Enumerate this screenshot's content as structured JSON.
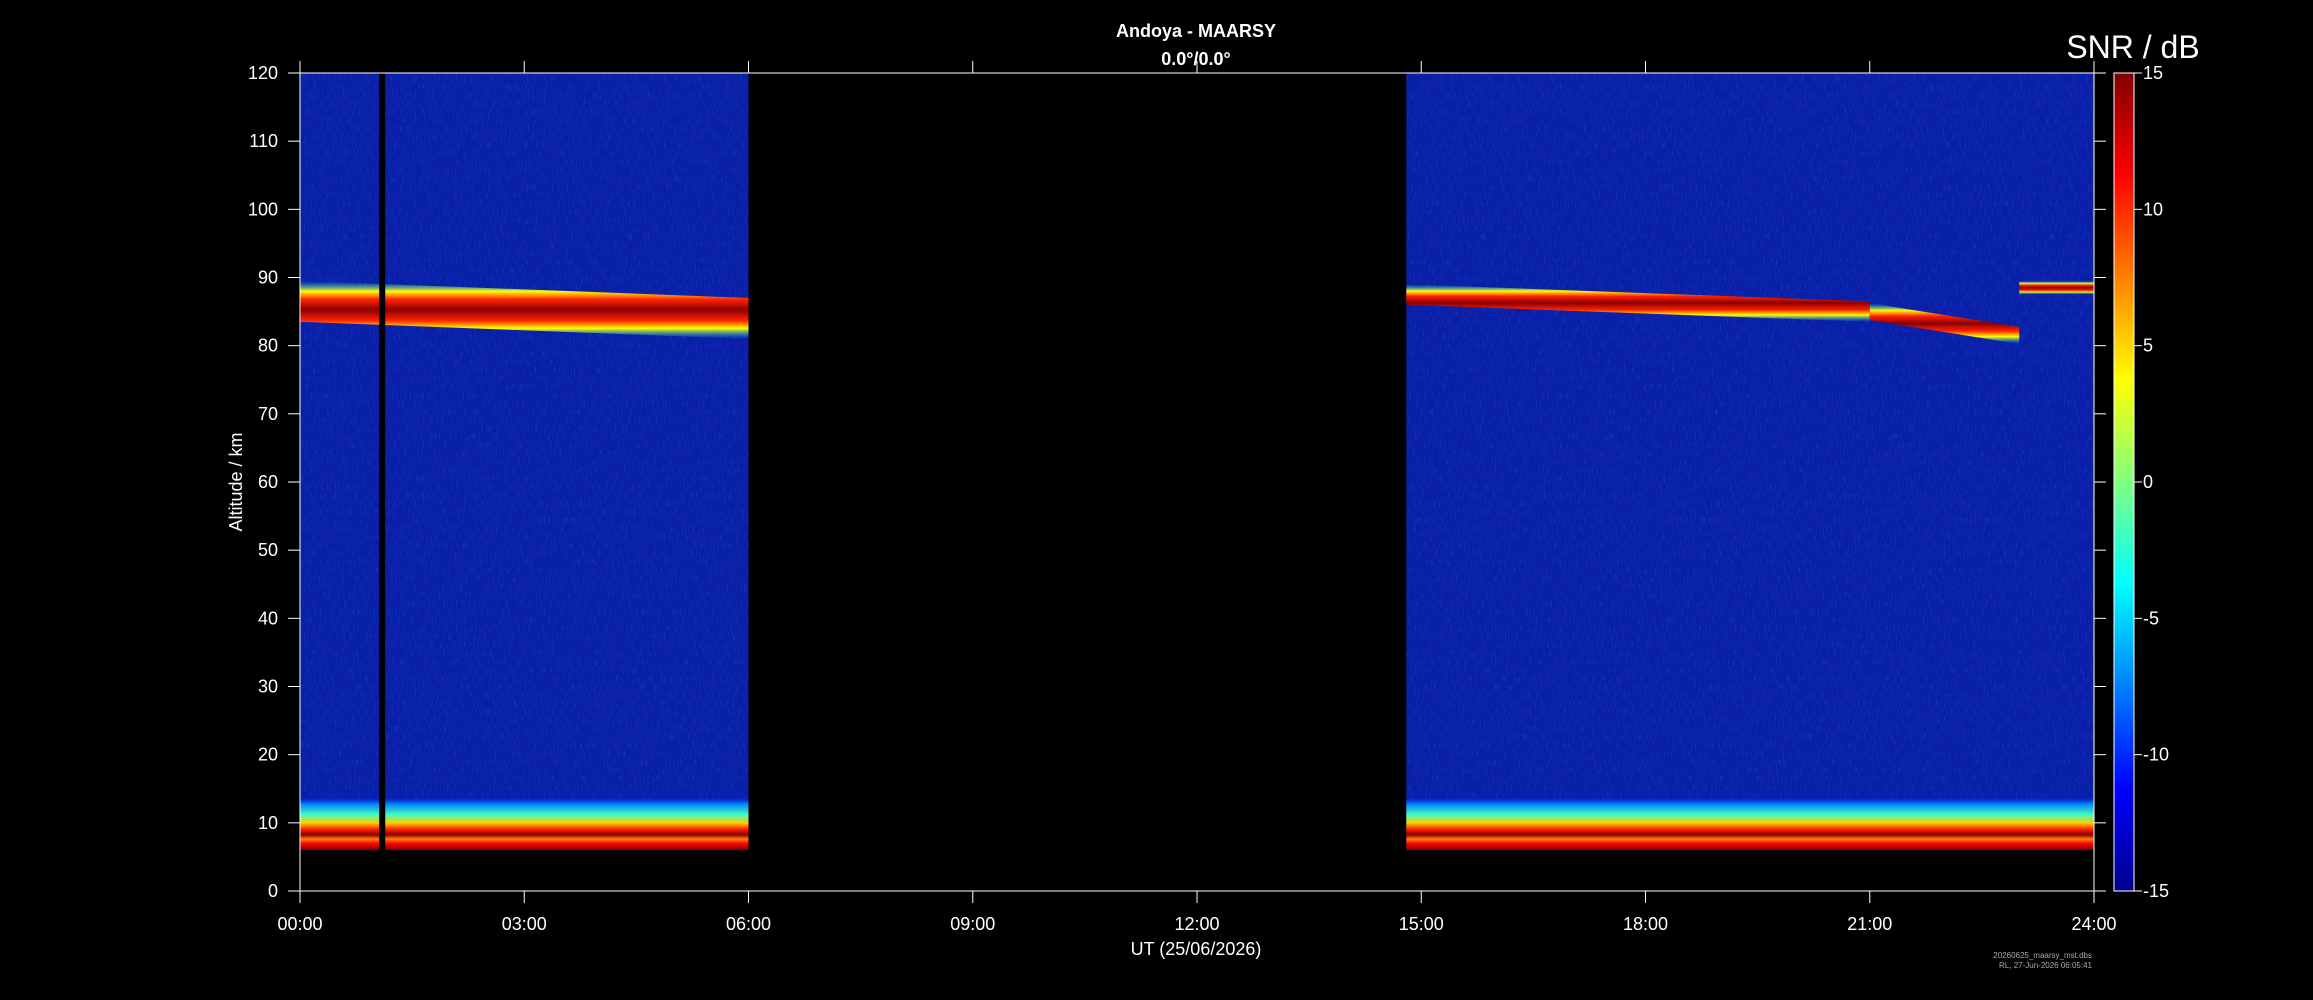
{
  "chart_data": {
    "type": "heatmap",
    "title": "Andoya - MAARSY",
    "subtitle": "0.0°/0.0°",
    "xlabel": "UT (25/06/2026)",
    "ylabel": "Altitude / km",
    "x_unit": "hours UT",
    "xlim": [
      0,
      24
    ],
    "ylim": [
      0,
      120
    ],
    "x_ticks": [
      0,
      3,
      6,
      9,
      12,
      15,
      18,
      21,
      24
    ],
    "x_tick_labels": [
      "00:00",
      "03:00",
      "06:00",
      "09:00",
      "12:00",
      "15:00",
      "18:00",
      "21:00",
      "24:00"
    ],
    "y_ticks": [
      0,
      10,
      20,
      30,
      40,
      50,
      60,
      70,
      80,
      90,
      100,
      110,
      120
    ],
    "y_tick_labels": [
      "0",
      "10",
      "20",
      "30",
      "40",
      "50",
      "60",
      "70",
      "80",
      "90",
      "100",
      "110",
      "120"
    ],
    "colorbar": {
      "title": "SNR / dB",
      "range": [
        -15,
        15
      ],
      "ticks": [
        15,
        10,
        5,
        0,
        -5,
        -10,
        -15
      ],
      "tick_labels": [
        "15",
        "10",
        "5",
        "0",
        "-5",
        "-10",
        "-15"
      ],
      "colormap": "jet"
    },
    "data_segments": [
      {
        "start": 0.0,
        "end": 6.0
      },
      {
        "start": 14.8,
        "end": 24.0
      }
    ],
    "data_gap_lines": [
      1.1
    ],
    "altitude_coverage": [
      6,
      120
    ],
    "background_snr_db": -12,
    "echo_layers": [
      {
        "name": "mesosphere",
        "segment": 0,
        "from_x": 0.0,
        "to_x": 6.0,
        "center_alt_start": 86.5,
        "center_alt_end": 84.0,
        "thickness_km": 6,
        "peak_snr_db": 15
      },
      {
        "name": "mesosphere",
        "segment": 1,
        "from_x": 14.8,
        "to_x": 21.0,
        "center_alt_start": 87.5,
        "center_alt_end": 85.0,
        "thickness_km": 3,
        "peak_snr_db": 13
      },
      {
        "name": "mesosphere",
        "segment": 1,
        "from_x": 21.0,
        "to_x": 23.0,
        "center_alt_start": 85.0,
        "center_alt_end": 81.5,
        "thickness_km": 2.5,
        "peak_snr_db": 15
      },
      {
        "name": "mesosphere",
        "segment": 1,
        "from_x": 23.0,
        "to_x": 24.0,
        "center_alt_start": 88.5,
        "center_alt_end": 88.5,
        "thickness_km": 2,
        "peak_snr_db": 8
      },
      {
        "name": "troposphere",
        "segment": 0,
        "from_x": 0.0,
        "to_x": 6.0,
        "center_alt_start": 10,
        "center_alt_end": 10,
        "thickness_km": 8,
        "peak_snr_db": 15
      },
      {
        "name": "troposphere",
        "segment": 1,
        "from_x": 14.8,
        "to_x": 24.0,
        "center_alt_start": 10,
        "center_alt_end": 10,
        "thickness_km": 8,
        "peak_snr_db": 15
      }
    ]
  },
  "footer": {
    "line1": "20260625_maarsy_mst.dbs",
    "line2": "RL, 27-Jun-2026 06:05:41"
  }
}
